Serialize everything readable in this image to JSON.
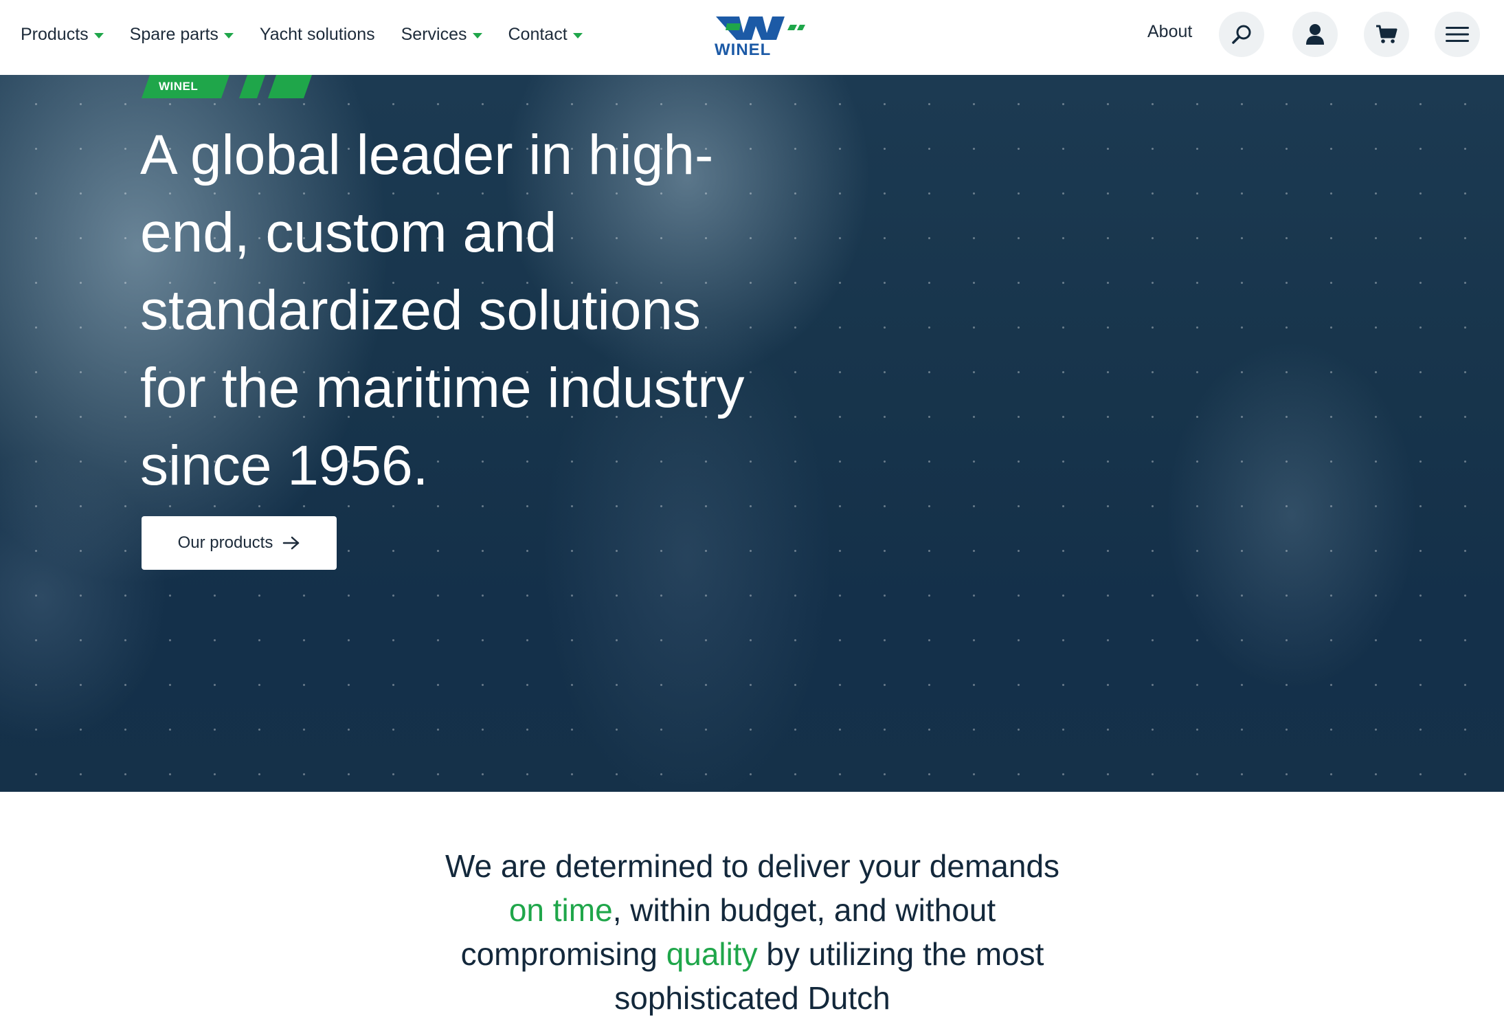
{
  "header": {
    "nav": [
      {
        "label": "Products",
        "has_dropdown": true
      },
      {
        "label": "Spare parts",
        "has_dropdown": true
      },
      {
        "label": "Yacht solutions",
        "has_dropdown": false
      },
      {
        "label": "Services",
        "has_dropdown": true
      },
      {
        "label": "Contact",
        "has_dropdown": true
      }
    ],
    "logo_text": "WINEL",
    "about_label": "About",
    "icons": [
      "search-icon",
      "user-icon",
      "cart-icon",
      "menu-icon"
    ]
  },
  "hero": {
    "tag": "WINEL",
    "title": "A global leader in high-end, custom and standardized solutions for the maritime industry since 1956.",
    "cta_label": "Our products"
  },
  "statement": {
    "part1": "We are determined to deliver your demands ",
    "highlight1": "on time",
    "part2": ", within budget, and without compromising ",
    "highlight2": "quality",
    "part3": " by utilizing the most sophisticated Dutch"
  },
  "colors": {
    "accent_green": "#1fa64a",
    "brand_blue": "#1c5aa6",
    "hero_navy": "#17344b"
  }
}
